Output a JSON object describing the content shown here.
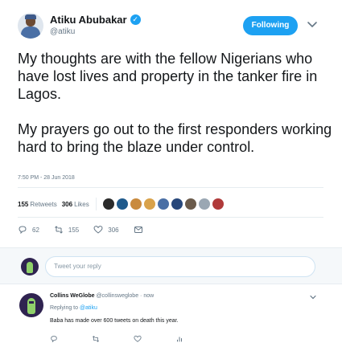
{
  "author": {
    "display_name": "Atiku Abubakar",
    "handle": "@atiku",
    "verified_icon": "verified-badge-icon",
    "avatar_icon": "profile-avatar"
  },
  "follow_button_label": "Following",
  "tweet": {
    "paragraphs": [
      "My thoughts are with the fellow Nigerians who have lost lives and property in the tanker fire in Lagos.",
      "My prayers go out to the first responders working hard to bring the blaze under control."
    ],
    "timestamp": "7:50 PM - 28 Jun 2018"
  },
  "stats": {
    "retweets_count": "155",
    "retweets_label": "Retweets",
    "likes_count": "306",
    "likes_label": "Likes",
    "liker_avatar_colors": [
      "#2b2b2b",
      "#1f5a8c",
      "#c98a3d",
      "#d9a24a",
      "#4a6fa5",
      "#27477a",
      "#6b5b4b",
      "#9aa7b3",
      "#b03a3a"
    ]
  },
  "actions": {
    "reply_count": "62",
    "retweet_count": "155",
    "like_count": "306"
  },
  "reply_box": {
    "placeholder": "Tweet your reply"
  },
  "reply": {
    "name": "Collins WeGlobe",
    "handle": "@collinsweglobe",
    "separator": "·",
    "time": "now",
    "replying_to_label": "Replying to",
    "replying_to_handle": "@atiku",
    "text": "Baba has made over 600 tweets on death this year."
  },
  "colors": {
    "brand_blue": "#1da1f2",
    "muted_text": "#657786",
    "divider": "#e6ecf0"
  }
}
